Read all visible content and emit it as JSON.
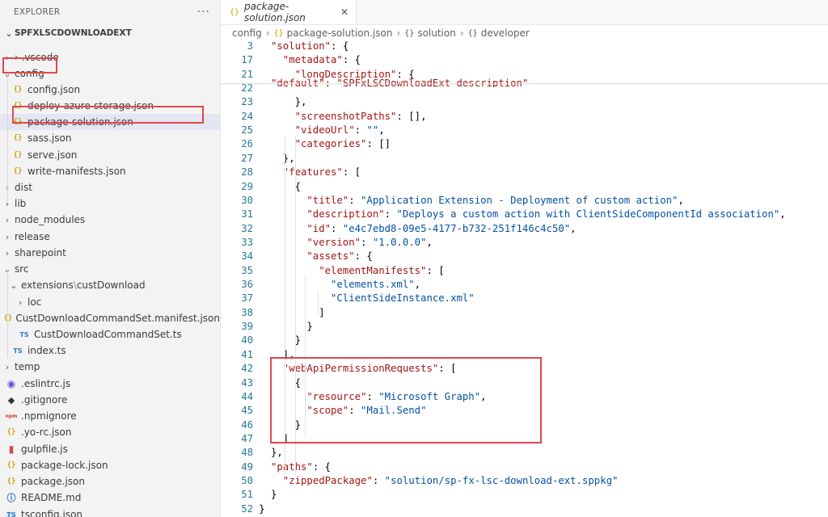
{
  "sidebar": {
    "title": "EXPLORER",
    "more": "···",
    "section": "SPFXLSCDOWNLOADEXT",
    "items": [
      {
        "label": "› .vscode"
      },
      {
        "label": "config"
      },
      {
        "label": "config.json"
      },
      {
        "label": "deploy-azure-storage.json"
      },
      {
        "label": "package-solution.json"
      },
      {
        "label": "sass.json"
      },
      {
        "label": "serve.json"
      },
      {
        "label": "write-manifests.json"
      },
      {
        "label": "dist"
      },
      {
        "label": "lib"
      },
      {
        "label": "node_modules"
      },
      {
        "label": "release"
      },
      {
        "label": "sharepoint"
      },
      {
        "label": "src"
      },
      {
        "label": "extensions",
        "label2": "custDownload"
      },
      {
        "label": "loc"
      },
      {
        "label": "CustDownloadCommandSet.manifest.json"
      },
      {
        "label": "CustDownloadCommandSet.ts"
      },
      {
        "label": "index.ts"
      },
      {
        "label": "temp"
      },
      {
        "label": ".eslintrc.js"
      },
      {
        "label": ".gitignore"
      },
      {
        "label": ".npmignore"
      },
      {
        "label": ".yo-rc.json"
      },
      {
        "label": "gulpfile.js"
      },
      {
        "label": "package-lock.json"
      },
      {
        "label": "package.json"
      },
      {
        "label": "README.md"
      },
      {
        "label": "tsconfig.json"
      }
    ],
    "icons": {
      "json": "{}",
      "ts": "TS",
      "npm": "npm"
    }
  },
  "editor": {
    "tab_label": "package-solution.json",
    "tab_close": "✕",
    "breadcrumb": [
      "config",
      "package-solution.json",
      "solution",
      "developer"
    ],
    "line_numbers": [
      "3",
      "17",
      "21",
      "22",
      "23",
      "24",
      "25",
      "26",
      "27",
      "28",
      "29",
      "30",
      "31",
      "32",
      "33",
      "34",
      "35",
      "36",
      "37",
      "38",
      "39",
      "40",
      "41",
      "42",
      "43",
      "44",
      "45",
      "46",
      "47",
      "48",
      "49",
      "50",
      "51",
      "52"
    ],
    "cut_text": "\"default\": \"SPFxLSCDownloadExt description\"",
    "lines": [
      "\"solution\": {",
      "\"metadata\": {",
      "\"longDescription\": {",
      "",
      "},",
      "\"screenshotPaths\": [],",
      "\"videoUrl\": \"\",",
      "\"categories\": []",
      "},",
      "\"features\": [",
      "{",
      "\"title\": \"Application Extension - Deployment of custom action\",",
      "\"description\": \"Deploys a custom action with ClientSideComponentId association\",",
      "\"id\": \"e4c7ebd8-09e5-4177-b732-251f146c4c50\",",
      "\"version\": \"1.0.0.0\",",
      "\"assets\": {",
      "\"elementManifests\": [",
      "\"elements.xml\",",
      "\"ClientSideInstance.xml\"",
      "]",
      "}",
      "}",
      "],",
      "\"webApiPermissionRequests\": [",
      "{",
      "\"resource\": \"Microsoft Graph\",",
      "\"scope\": \"Mail.Send\"",
      "}",
      "]",
      "},",
      "\"paths\": {",
      "\"zippedPackage\": \"solution/sp-fx-lsc-download-ext.sppkg\"",
      "}",
      "}"
    ]
  }
}
